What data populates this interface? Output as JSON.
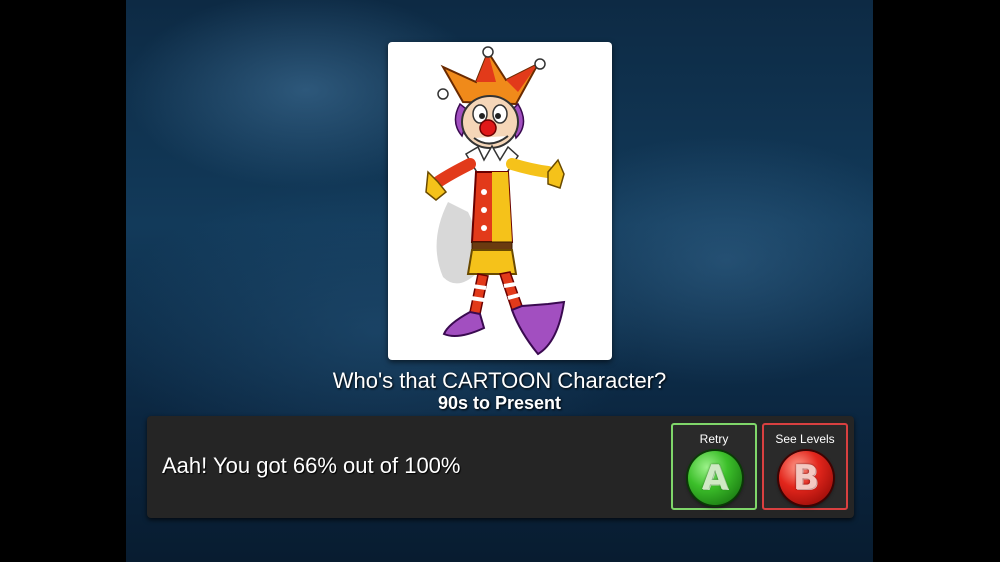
{
  "quiz": {
    "question": "Who's that CARTOON Character?",
    "category": "90s to Present"
  },
  "result": {
    "message": "Aah! You got 66% out of 100%"
  },
  "buttons": {
    "retry": {
      "label": "Retry",
      "key": "A",
      "color": "#3cbf2a"
    },
    "levels": {
      "label": "See Levels",
      "key": "B",
      "color": "#e3261c"
    }
  },
  "image": {
    "icon": "jester-clown-illustration"
  }
}
